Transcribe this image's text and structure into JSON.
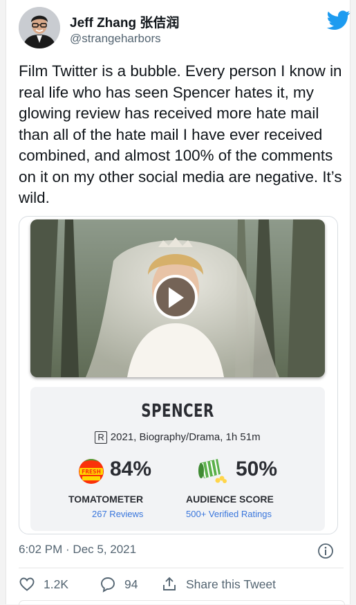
{
  "author": {
    "display_name": "Jeff Zhang 张佶润",
    "handle": "@strangeharbors"
  },
  "tweet": {
    "text": "Film Twitter is a bubble. Every person I know in real life who has seen Spencer hates it, my glowing review has received more hate mail than all of the hate mail I have ever received combined, and almost 100% of the comments on it on my other social media are negative. It’s wild.",
    "timestamp": "6:02 PM · Dec 5, 2021"
  },
  "movie_card": {
    "title": "SPENCER",
    "rating": "R",
    "info": "2021, Biography/Drama, 1h 51m",
    "tomatometer": {
      "percent": "84%",
      "label": "TOMATOMETER",
      "sub": "267 Reviews",
      "badge_text": "FRESH"
    },
    "audience": {
      "percent": "50%",
      "label": "AUDIENCE SCORE",
      "sub": "500+ Verified Ratings"
    }
  },
  "actions": {
    "likes": "1.2K",
    "replies": "94",
    "share": "Share this Tweet"
  },
  "colors": {
    "twitter_blue": "#1d9bf0",
    "link_blue": "#3976dc",
    "muted": "#536471",
    "tomato_red": "#fa320a"
  },
  "icons": [
    "twitter-bird-icon",
    "play-icon",
    "certified-fresh-icon",
    "spilled-popcorn-icon",
    "info-icon",
    "heart-icon",
    "reply-icon",
    "share-icon"
  ]
}
